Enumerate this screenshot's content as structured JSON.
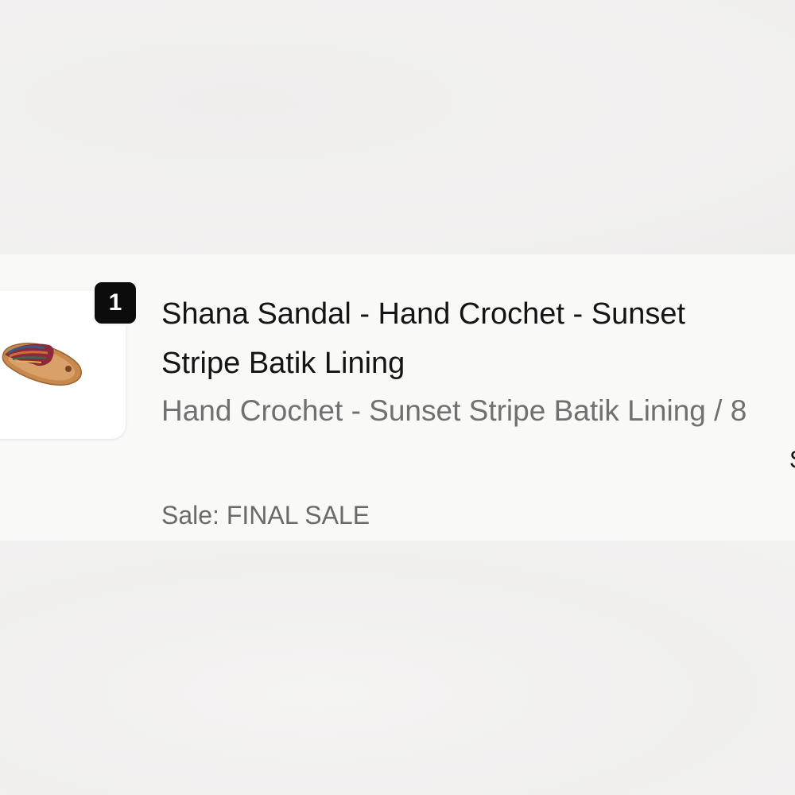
{
  "order_summary": {
    "line_items": [
      {
        "quantity": "1",
        "image_icon": "flip-flop-sandal-icon",
        "title": "Shana Sandal - Hand Crochet - Sunset Stripe Batik Lining",
        "variant": "Hand Crochet - Sunset Stripe Batik Lining / 8",
        "discount_note": "Sale: FINAL SALE",
        "price_fragment": "$"
      }
    ]
  }
}
